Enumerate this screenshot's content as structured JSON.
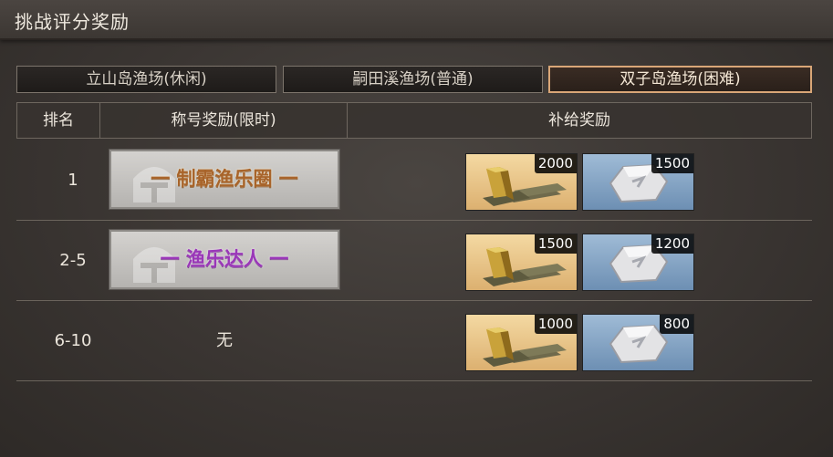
{
  "window": {
    "title": "挑战评分奖励"
  },
  "tabs": [
    {
      "label": "立山岛渔场(休闲)",
      "active": false
    },
    {
      "label": "嗣田溪渔场(普通)",
      "active": false
    },
    {
      "label": "双子岛渔场(困难)",
      "active": true
    }
  ],
  "table": {
    "headers": {
      "rank": "排名",
      "title_reward": "称号奖励(限时)",
      "supply_reward": "补给奖励"
    },
    "rows": [
      {
        "rank": "1",
        "title": "一 制霸渔乐圈 一",
        "title_color": "#a8642a",
        "gold": "2000",
        "silver": "1500"
      },
      {
        "rank": "2-5",
        "title": "一 渔乐达人 一",
        "title_color": "#9a37b8",
        "gold": "1500",
        "silver": "1200"
      },
      {
        "rank": "6-10",
        "title": "无",
        "gold": "1000",
        "silver": "800"
      }
    ]
  },
  "icons": {
    "gold": "gold-bars-icon",
    "silver": "silver-ore-icon",
    "emblem": "helmet-emblem-icon"
  },
  "colors": {
    "active_tab_border": "#d9a677"
  }
}
